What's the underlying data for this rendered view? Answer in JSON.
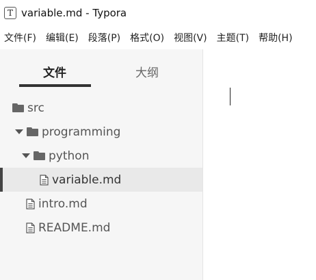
{
  "window": {
    "app_icon_letter": "T",
    "title": "variable.md - Typora"
  },
  "menu": [
    {
      "label": "文件(F)"
    },
    {
      "label": "编辑(E)"
    },
    {
      "label": "段落(P)"
    },
    {
      "label": "格式(O)"
    },
    {
      "label": "视图(V)"
    },
    {
      "label": "主题(T)"
    },
    {
      "label": "帮助(H)"
    }
  ],
  "sidebar": {
    "tabs": [
      {
        "label": "文件",
        "active": true
      },
      {
        "label": "大纲",
        "active": false
      }
    ],
    "tree": [
      {
        "label": "src",
        "type": "folder",
        "expanded": true,
        "selected": false,
        "depth": 0
      },
      {
        "label": "programming",
        "type": "folder",
        "expanded": true,
        "selected": false,
        "depth": 1
      },
      {
        "label": "python",
        "type": "folder",
        "expanded": true,
        "selected": false,
        "depth": 2
      },
      {
        "label": "variable.md",
        "type": "file",
        "selected": true,
        "depth": 3
      },
      {
        "label": "intro.md",
        "type": "file",
        "selected": false,
        "depth": 1
      },
      {
        "label": "README.md",
        "type": "file",
        "selected": false,
        "depth": 1
      }
    ]
  },
  "colors": {
    "sidebar_background": "#f6f6f6",
    "selected_row": "#e9e9e9",
    "active_tab_underline": "#333333"
  }
}
